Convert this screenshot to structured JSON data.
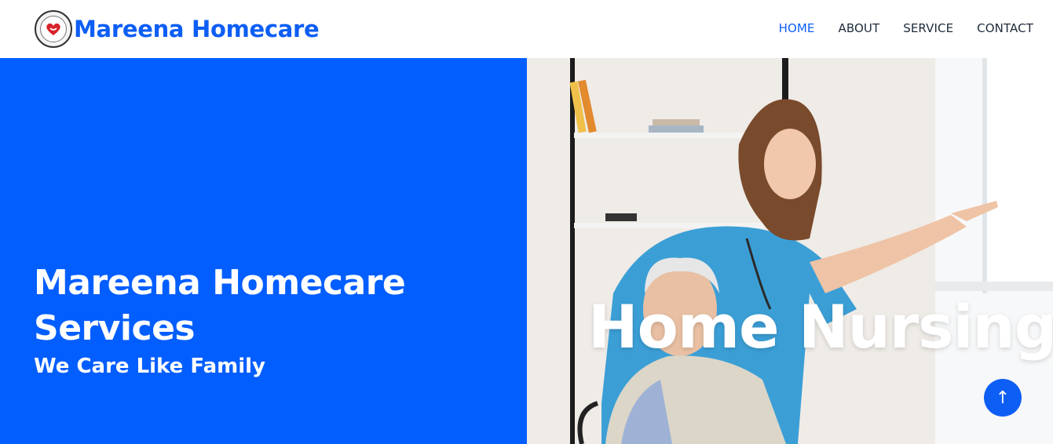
{
  "header": {
    "brand_name": "Mareena Homecare",
    "logo_icon": "heart-hands-logo-icon",
    "nav": [
      {
        "label": "HOME",
        "active": true
      },
      {
        "label": "ABOUT",
        "active": false
      },
      {
        "label": "SERVICE",
        "active": false
      },
      {
        "label": "CONTACT",
        "active": false
      }
    ]
  },
  "hero": {
    "title_line1": "Mareena Homecare",
    "title_line2": "Services",
    "subtitle": "We Care Like Family",
    "image_caption": "Home Nursing",
    "background_color": "#035eff",
    "image_alt": "nurse pointing out window with elderly man in wheelchair"
  },
  "scroll_top": {
    "icon": "arrow-up-icon",
    "glyph": "↑"
  },
  "colors": {
    "accent": "#0d5ef4",
    "nav_text": "#1d2b3a",
    "white": "#ffffff"
  }
}
